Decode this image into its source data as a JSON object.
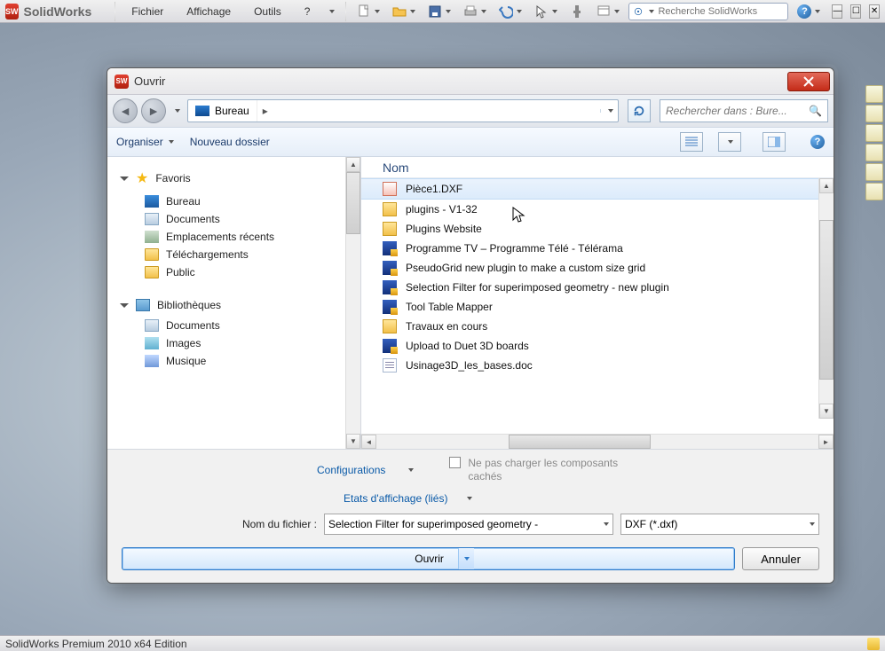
{
  "app": {
    "logo_text": "SW",
    "name": "SolidWorks",
    "menus": [
      "Fichier",
      "Affichage",
      "Outils",
      "?"
    ],
    "search_placeholder": "Recherche SolidWorks",
    "status": "SolidWorks Premium 2010 x64 Edition"
  },
  "dialog": {
    "title": "Ouvrir",
    "breadcrumb_location": "Bureau",
    "organise": "Organiser",
    "new_folder": "Nouveau dossier",
    "search_placeholder": "Rechercher dans : Bure...",
    "files_column": "Nom",
    "tree": {
      "favorites": {
        "title": "Favoris",
        "items": [
          "Bureau",
          "Documents",
          "Emplacements récents",
          "Téléchargements",
          "Public"
        ]
      },
      "libraries": {
        "title": "Bibliothèques",
        "items": [
          "Documents",
          "Images",
          "Musique"
        ]
      }
    },
    "files": [
      {
        "name": "Pièce1.DXF",
        "icon": "dxf",
        "selected": true
      },
      {
        "name": "plugins - V1-32",
        "icon": "folder",
        "selected": false
      },
      {
        "name": "Plugins Website",
        "icon": "folder",
        "selected": false
      },
      {
        "name": "Programme TV – Programme Télé - Télérama",
        "icon": "url",
        "selected": false
      },
      {
        "name": "PseudoGrid new plugin to make a custom size grid",
        "icon": "url",
        "selected": false
      },
      {
        "name": "Selection Filter for superimposed geometry - new plugin",
        "icon": "url",
        "selected": false
      },
      {
        "name": "Tool Table Mapper",
        "icon": "url",
        "selected": false
      },
      {
        "name": "Travaux en cours",
        "icon": "folder",
        "selected": false
      },
      {
        "name": "Upload to Duet 3D boards",
        "icon": "url",
        "selected": false
      },
      {
        "name": "Usinage3D_les_bases.doc",
        "icon": "doc",
        "selected": false
      }
    ],
    "config_label": "Configurations",
    "display_states_label": "Etats d'affichage (liés)",
    "dont_load_hidden": "Ne pas charger les composants cachés",
    "filename_label": "Nom du fichier :",
    "filename_value": "Selection Filter for superimposed geometry - ",
    "filetype_value": "DXF (*.dxf)",
    "open_btn": "Ouvrir",
    "cancel_btn": "Annuler"
  }
}
